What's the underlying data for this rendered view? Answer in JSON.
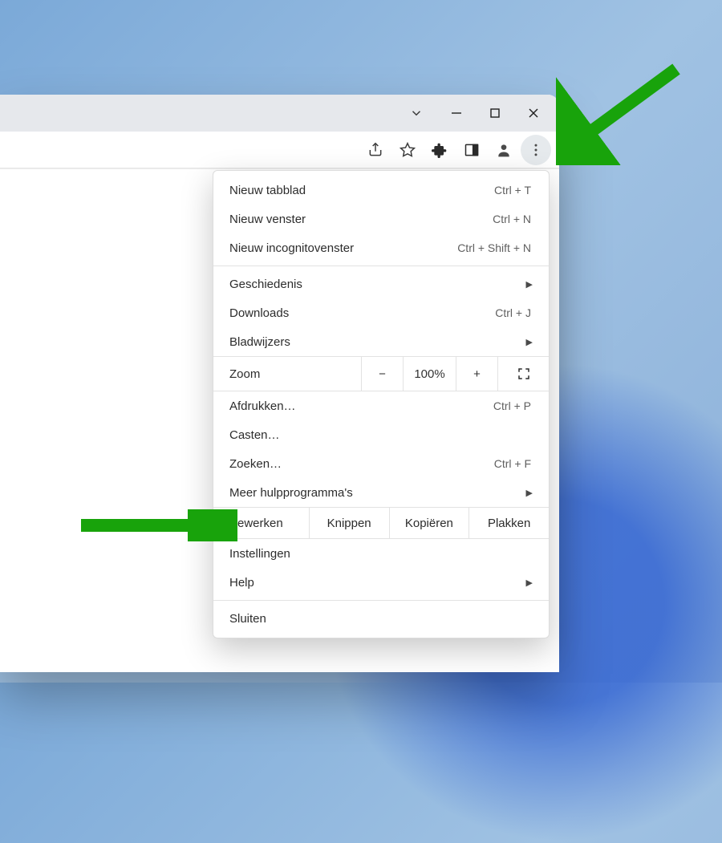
{
  "menu": {
    "newTab": {
      "label": "Nieuw tabblad",
      "shortcut": "Ctrl + T"
    },
    "newWindow": {
      "label": "Nieuw venster",
      "shortcut": "Ctrl + N"
    },
    "newIncognito": {
      "label": "Nieuw incognitovenster",
      "shortcut": "Ctrl + Shift + N"
    },
    "history": {
      "label": "Geschiedenis"
    },
    "downloads": {
      "label": "Downloads",
      "shortcut": "Ctrl + J"
    },
    "bookmarks": {
      "label": "Bladwijzers"
    },
    "zoom": {
      "label": "Zoom",
      "level": "100%"
    },
    "print": {
      "label": "Afdrukken…",
      "shortcut": "Ctrl + P"
    },
    "cast": {
      "label": "Casten…"
    },
    "find": {
      "label": "Zoeken…",
      "shortcut": "Ctrl + F"
    },
    "moreTools": {
      "label": "Meer hulpprogramma's"
    },
    "edit": {
      "label": "Bewerken",
      "cut": "Knippen",
      "copy": "Kopiëren",
      "paste": "Plakken"
    },
    "settings": {
      "label": "Instellingen"
    },
    "help": {
      "label": "Help"
    },
    "exit": {
      "label": "Sluiten"
    }
  }
}
